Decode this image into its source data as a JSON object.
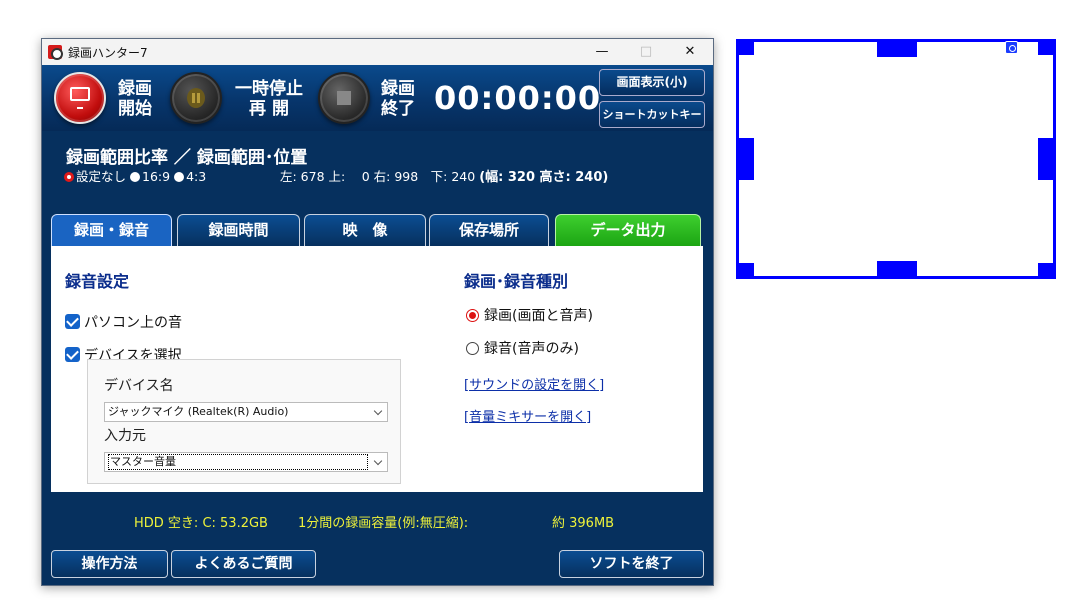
{
  "window": {
    "title": "録画ハンター7",
    "minimize": "—",
    "maximize": "□",
    "close": "✕"
  },
  "toolbar": {
    "record_label": "録画\n開始",
    "pause_label": "一時停止\n再 開",
    "stop_label": "録画\n終了",
    "timer": "00:00:00",
    "display_button": "画面表示(小)",
    "shortcut_button": "ショートカットキー"
  },
  "range": {
    "title": "録画範囲比率 ／ 録画範囲･位置",
    "ratio_options": [
      {
        "label": "設定なし",
        "selected": true
      },
      {
        "label": "16:9",
        "selected": false
      },
      {
        "label": "4:3",
        "selected": false
      }
    ],
    "coords_text": "左: 678 上: 　0 右: 998　下: 240",
    "size_text": "(幅: 320 高さ: 240)"
  },
  "tabs": [
    "録画・録音",
    "録画時間",
    "映　像",
    "保存場所",
    "データ出力"
  ],
  "audio": {
    "title": "録音設定",
    "pc_sound": "パソコン上の音",
    "select_device": "デバイスを選択",
    "device_name_label": "デバイス名",
    "device_value": "ジャックマイク (Realtek(R) Audio)",
    "input_label": "入力元",
    "input_value": "マスター音量"
  },
  "type": {
    "title": "録画･録音種別",
    "option_video": "録画(画面と音声)",
    "option_audio": "録音(音声のみ)",
    "link_sound": "[サウンドの設定を開く]",
    "link_mixer": "[音量ミキサーを開く]"
  },
  "status": {
    "hdd": "HDD 空き: C: 53.2GB",
    "per_minute": "1分間の録画容量(例:無圧縮):",
    "estimate": "約 396MB"
  },
  "footer": {
    "how_to": "操作方法",
    "faq": "よくあるご質問",
    "exit": "ソフトを終了"
  },
  "colors": {
    "window_bg": "#06305e",
    "frame": "#0000ff",
    "status_text": "#eef23a",
    "active_tab": "#1a64c2",
    "green_tab": "#1ca513"
  }
}
